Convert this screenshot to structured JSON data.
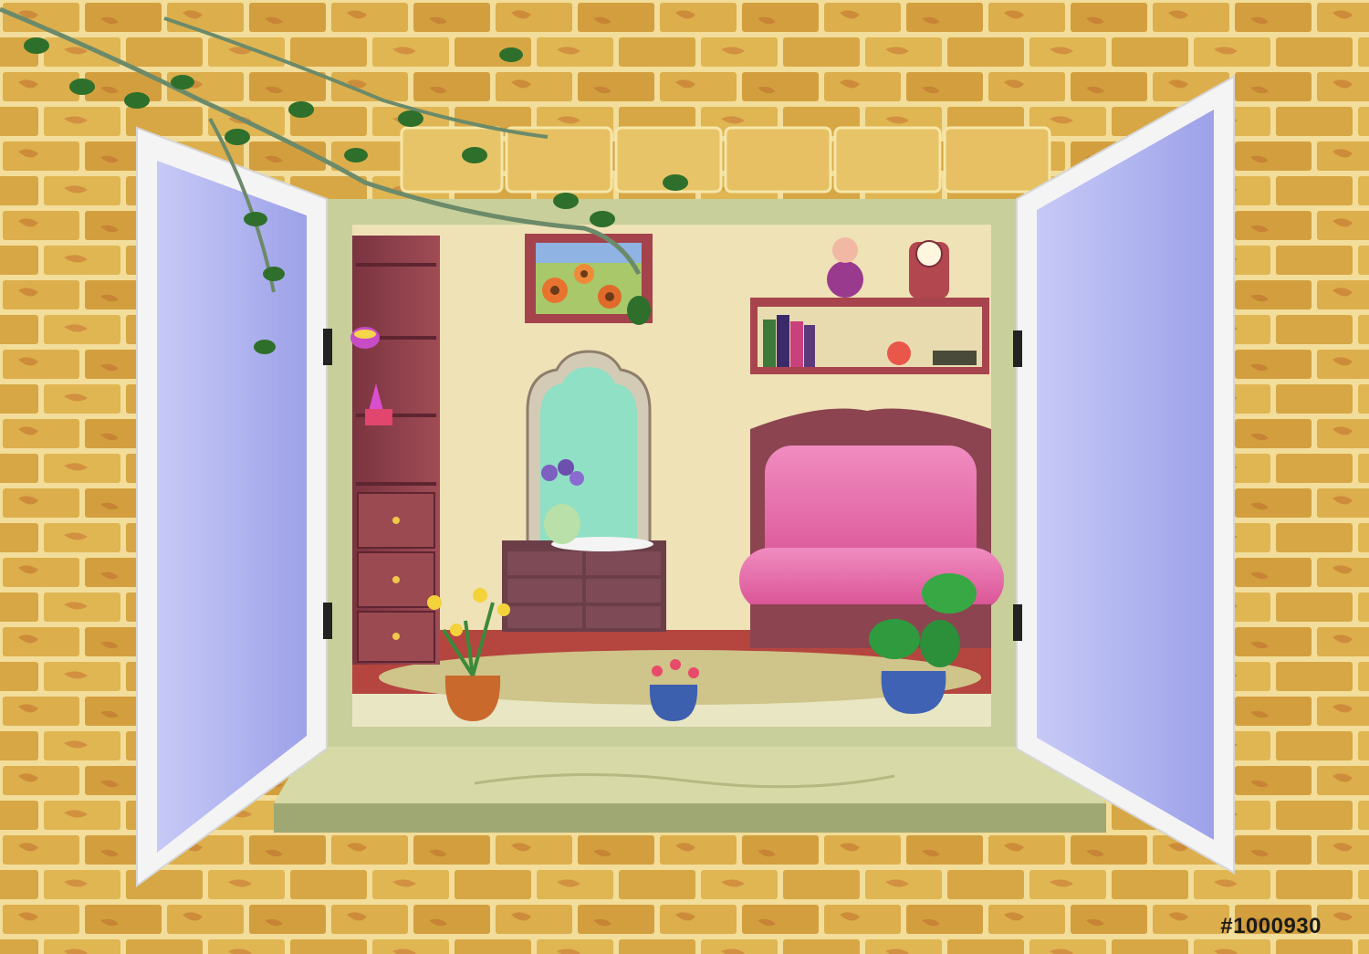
{
  "image": {
    "kind": "illustration",
    "stock_id_label": "#1000930",
    "colors": {
      "brick": "#d9a94a",
      "brick_shade": "#b8862c",
      "mortar": "#f2e1a0",
      "window_frame": "#f4f4f4",
      "glass": "#b9bdf2",
      "room_wall": "#efe2b6",
      "sofa": "#e768a6",
      "furniture": "#8a3f4a",
      "sill": "#c8cf9a"
    }
  }
}
